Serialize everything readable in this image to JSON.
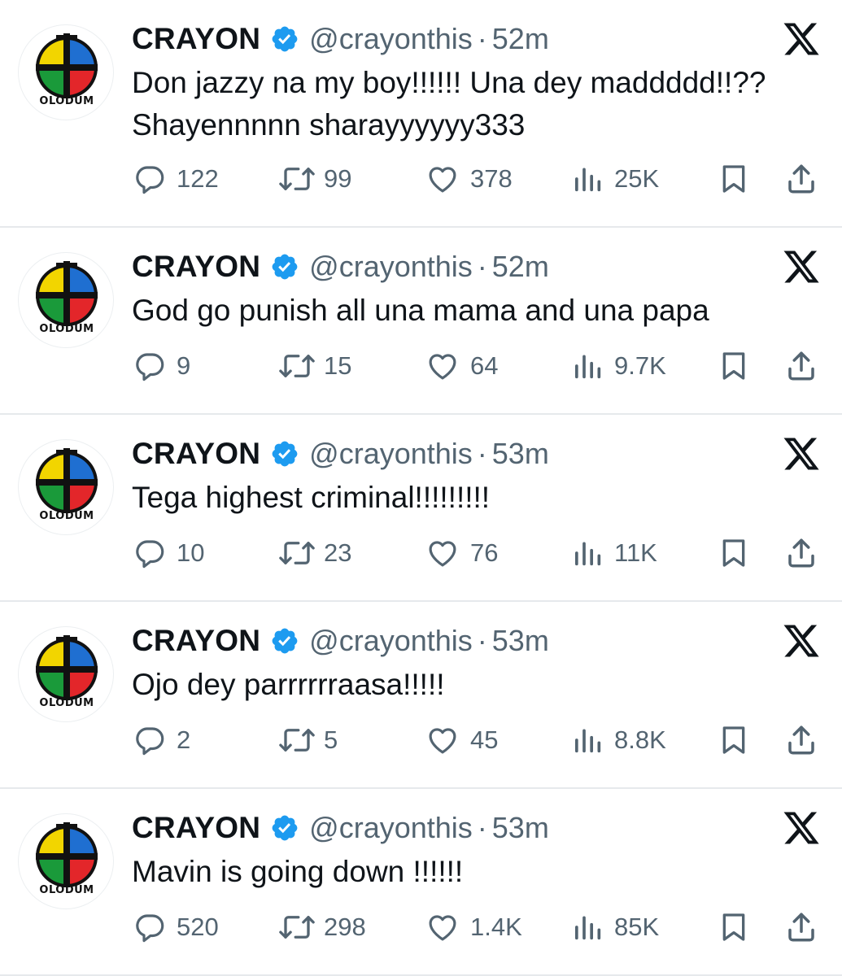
{
  "tweets": [
    {
      "display_name": "CRAYON",
      "handle": "@crayonthis",
      "separator": "·",
      "time": "52m",
      "avatar_label": "OLODUM",
      "text": "Don jazzy na my boy!!!!!! Una dey maddddd!!??\nShayennnnn sharayyyyyy333",
      "replies": "122",
      "reposts": "99",
      "likes": "378",
      "views": "25K"
    },
    {
      "display_name": "CRAYON",
      "handle": "@crayonthis",
      "separator": "·",
      "time": "52m",
      "avatar_label": "OLODUM",
      "text": "God go punish all una mama and una papa",
      "replies": "9",
      "reposts": "15",
      "likes": "64",
      "views": "9.7K"
    },
    {
      "display_name": "CRAYON",
      "handle": "@crayonthis",
      "separator": "·",
      "time": "53m",
      "avatar_label": "OLODUM",
      "text": "Tega highest criminal!!!!!!!!!",
      "replies": "10",
      "reposts": "23",
      "likes": "76",
      "views": "11K"
    },
    {
      "display_name": "CRAYON",
      "handle": "@crayonthis",
      "separator": "·",
      "time": "53m",
      "avatar_label": "OLODUM",
      "text": "Ojo dey parrrrrraasa!!!!!",
      "replies": "2",
      "reposts": "5",
      "likes": "45",
      "views": "8.8K"
    },
    {
      "display_name": "CRAYON",
      "handle": "@crayonthis",
      "separator": "·",
      "time": "53m",
      "avatar_label": "OLODUM",
      "text": "Mavin is going down !!!!!!",
      "replies": "520",
      "reposts": "298",
      "likes": "1.4K",
      "views": "85K"
    }
  ],
  "icons": {
    "reply": "reply-icon",
    "repost": "repost-icon",
    "like": "like-icon",
    "views": "views-icon",
    "bookmark": "bookmark-icon",
    "share": "share-icon",
    "verified": "verified-badge-icon",
    "platform": "x-logo-icon"
  },
  "colors": {
    "verified_blue": "#1d9bf0",
    "text_primary": "#0f1419",
    "text_secondary": "#536471",
    "avatar_yellow": "#f2d500",
    "avatar_blue": "#1f6fd1",
    "avatar_green": "#1a9a3a",
    "avatar_red": "#e3262a"
  }
}
